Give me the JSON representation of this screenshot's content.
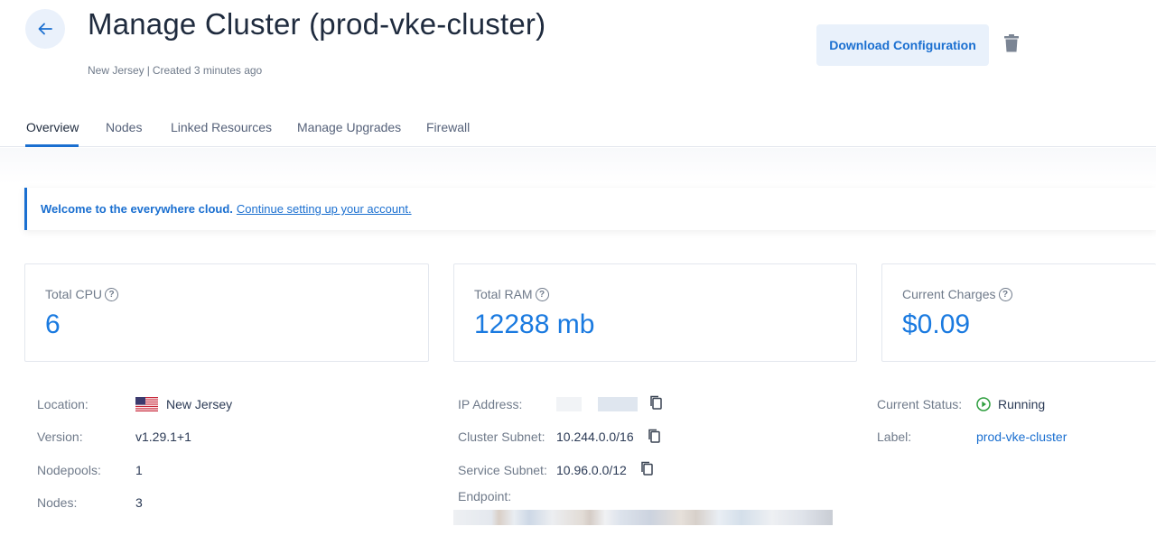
{
  "header": {
    "title": "Manage Cluster (prod-vke-cluster)",
    "location": "New Jersey",
    "separator": "|",
    "created": "Created 3 minutes ago",
    "download_label": "Download Configuration"
  },
  "tabs": [
    {
      "label": "Overview",
      "active": true
    },
    {
      "label": "Nodes",
      "active": false
    },
    {
      "label": "Linked Resources",
      "active": false
    },
    {
      "label": "Manage Upgrades",
      "active": false
    },
    {
      "label": "Firewall",
      "active": false
    }
  ],
  "banner": {
    "strong": "Welcome to the everywhere cloud.",
    "link": "Continue setting up your account."
  },
  "cards": [
    {
      "label": "Total CPU",
      "value": "6"
    },
    {
      "label": "Total RAM",
      "value": "12288 mb"
    },
    {
      "label": "Current Charges",
      "value": "$0.09"
    }
  ],
  "details": {
    "location_label": "Location:",
    "location_value": "New Jersey",
    "version_label": "Version:",
    "version_value": "v1.29.1+1",
    "nodepools_label": "Nodepools:",
    "nodepools_value": "1",
    "nodes_label": "Nodes:",
    "nodes_value": "3",
    "ip_label": "IP Address:",
    "cluster_subnet_label": "Cluster Subnet:",
    "cluster_subnet_value": "10.244.0.0/16",
    "service_subnet_label": "Service Subnet:",
    "service_subnet_value": "10.96.0.0/12",
    "endpoint_label": "Endpoint:",
    "status_label": "Current Status:",
    "status_value": "Running",
    "label_label": "Label:",
    "label_value": "prod-vke-cluster"
  },
  "colors": {
    "accent": "#1a6fd0",
    "status_running": "#2e9e3e"
  },
  "icons": [
    "arrow-left-icon",
    "trash-icon",
    "help-circle-icon",
    "us-flag-icon",
    "copy-icon",
    "play-circle-icon"
  ]
}
